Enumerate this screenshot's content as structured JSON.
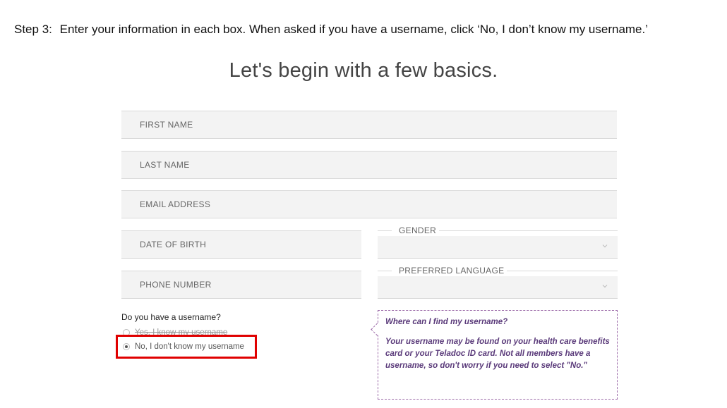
{
  "instruction": {
    "label": "Step 3:",
    "text": "Enter your information in each box.  When asked if you have a username, click ‘No, I don’t know my username.’"
  },
  "form": {
    "title": "Let's begin with a few basics.",
    "first_name": {
      "placeholder": "FIRST NAME",
      "value": ""
    },
    "last_name": {
      "placeholder": "LAST NAME",
      "value": ""
    },
    "email": {
      "placeholder": "EMAIL ADDRESS",
      "value": ""
    },
    "dob": {
      "placeholder": "DATE OF BIRTH",
      "value": ""
    },
    "phone": {
      "placeholder": "PHONE NUMBER",
      "value": ""
    },
    "gender": {
      "label": "GENDER",
      "value": ""
    },
    "language": {
      "label": "PREFERRED LANGUAGE",
      "value": ""
    },
    "username_question": "Do you have a username?",
    "username_options": [
      {
        "label": "Yes, I know my username",
        "selected": false
      },
      {
        "label": "No, I don't know my username",
        "selected": true
      }
    ]
  },
  "tooltip": {
    "heading": "Where can I find my username?",
    "body": "Your username may be found on your health care benefits card or your Teladoc ID card. Not all members have a username, so don't worry if you need to select \"No.\""
  },
  "colors": {
    "highlight": "#e00000",
    "tooltip_text": "#5a3a7a",
    "tooltip_border": "#9c6aa8"
  }
}
